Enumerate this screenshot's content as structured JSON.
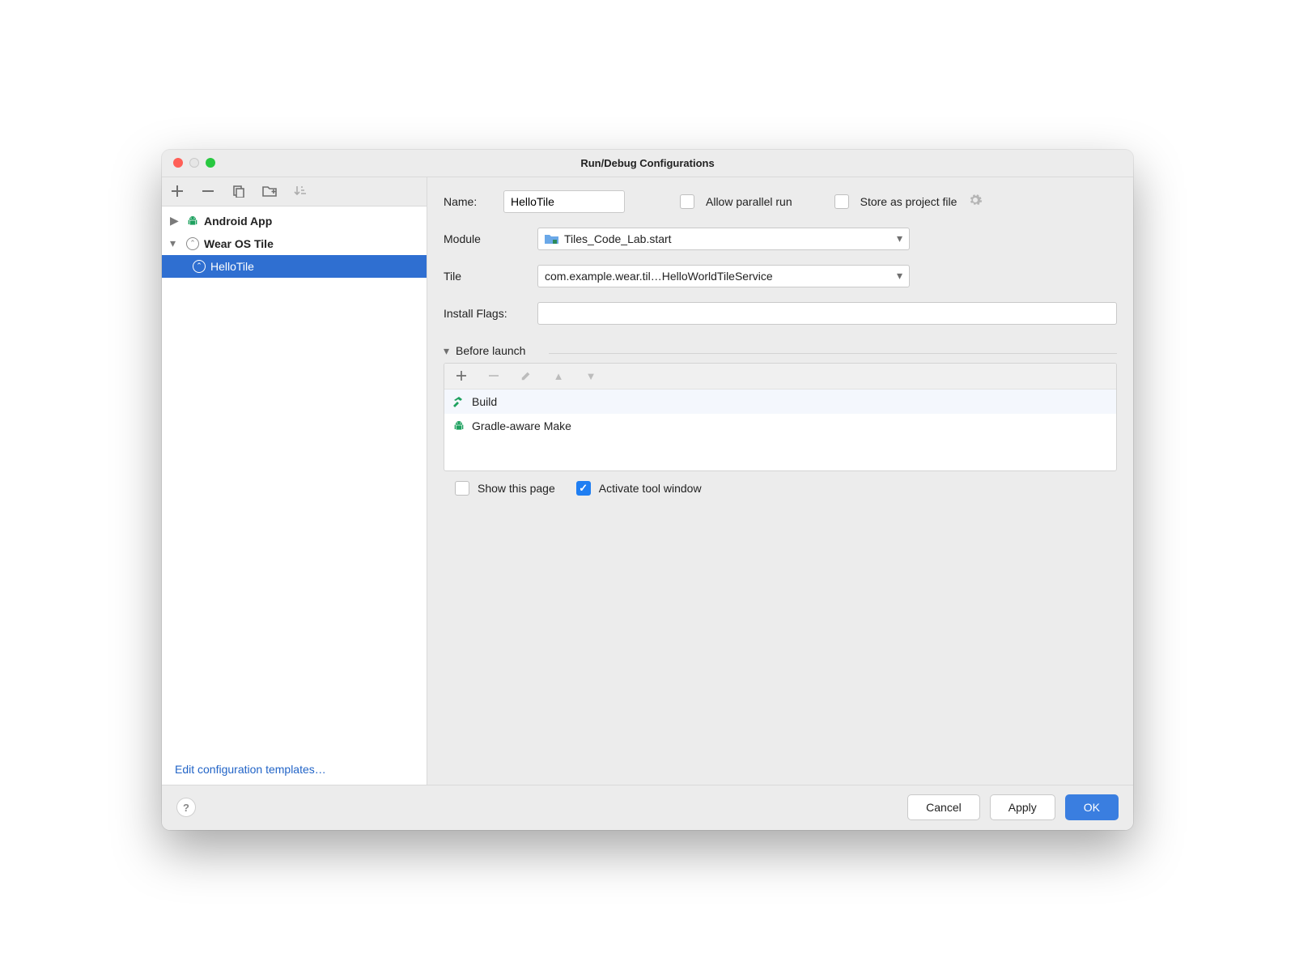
{
  "window_title": "Run/Debug Configurations",
  "tree": {
    "nodes": [
      {
        "label": "Android App",
        "expanded": false,
        "bold": true
      },
      {
        "label": "Wear OS Tile",
        "expanded": true,
        "bold": true
      },
      {
        "label": "HelloTile",
        "selected": true
      }
    ]
  },
  "templates_link": "Edit configuration templates…",
  "fields": {
    "name_label": "Name:",
    "name_value": "HelloTile",
    "allow_parallel_label": "Allow parallel run",
    "allow_parallel_checked": false,
    "store_label": "Store as project file",
    "store_checked": false,
    "module_label": "Module",
    "module_value": "Tiles_Code_Lab.start",
    "tile_label": "Tile",
    "tile_value": "com.example.wear.til…HelloWorldTileService",
    "install_flags_label": "Install Flags:",
    "install_flags_value": ""
  },
  "before_launch": {
    "title": "Before launch",
    "items": [
      {
        "label": "Build",
        "icon": "hammer"
      },
      {
        "label": "Gradle-aware Make",
        "icon": "android"
      }
    ]
  },
  "show_page": {
    "label": "Show this page",
    "checked": false
  },
  "activate_tool": {
    "label": "Activate tool window",
    "checked": true
  },
  "buttons": {
    "cancel": "Cancel",
    "apply": "Apply",
    "ok": "OK"
  }
}
